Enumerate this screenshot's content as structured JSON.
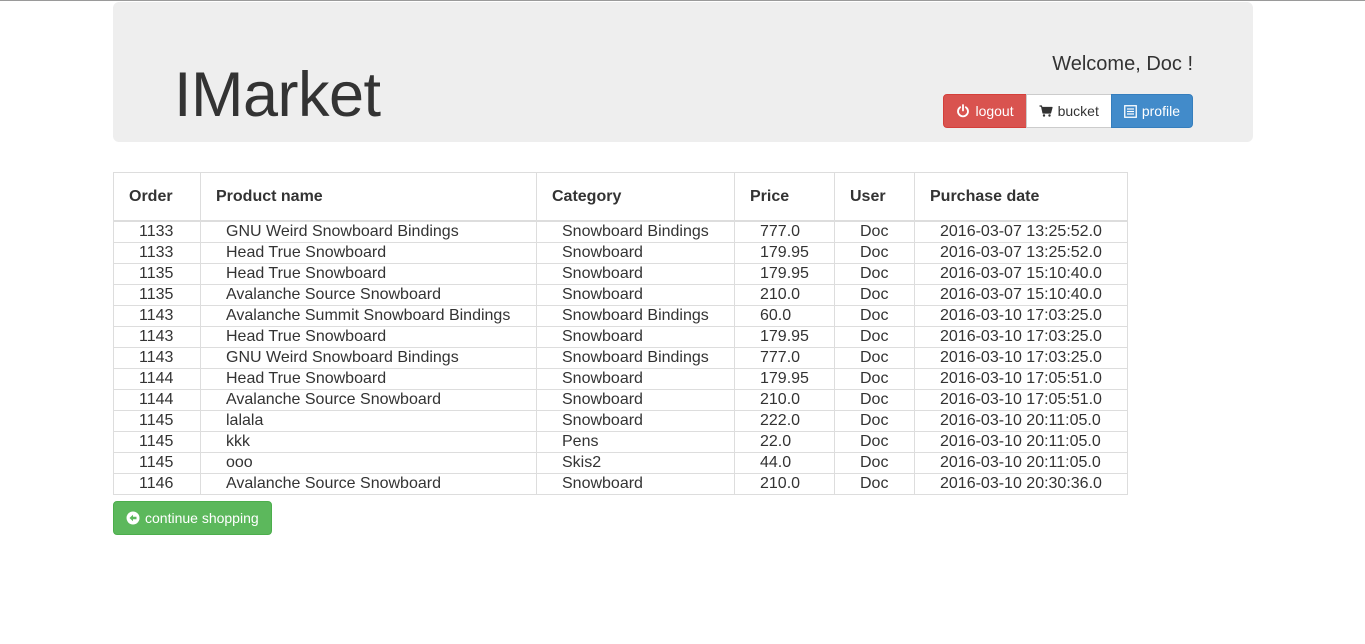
{
  "header": {
    "brand": "IMarket",
    "welcome": "Welcome, Doc !",
    "buttons": {
      "logout": "logout",
      "bucket": "bucket",
      "profile": "profile"
    }
  },
  "colors": {
    "logout": "#d9534f",
    "profile": "#428bca",
    "continue": "#5cb85c",
    "jumbotron": "#eeeeee"
  },
  "icons": {
    "logout": "power-icon",
    "bucket": "cart-icon",
    "profile": "list-icon",
    "continue": "circle-arrow-left-icon"
  },
  "table": {
    "headers": [
      "Order",
      "Product name",
      "Category",
      "Price",
      "User",
      "Purchase date"
    ],
    "rows": [
      [
        "1133",
        "GNU Weird Snowboard Bindings",
        "Snowboard Bindings",
        "777.0",
        "Doc",
        "2016-03-07 13:25:52.0"
      ],
      [
        "1133",
        "Head True Snowboard",
        "Snowboard",
        "179.95",
        "Doc",
        "2016-03-07 13:25:52.0"
      ],
      [
        "1135",
        "Head True Snowboard",
        "Snowboard",
        "179.95",
        "Doc",
        "2016-03-07 15:10:40.0"
      ],
      [
        "1135",
        "Avalanche Source Snowboard",
        "Snowboard",
        "210.0",
        "Doc",
        "2016-03-07 15:10:40.0"
      ],
      [
        "1143",
        "Avalanche Summit Snowboard Bindings",
        "Snowboard Bindings",
        "60.0",
        "Doc",
        "2016-03-10 17:03:25.0"
      ],
      [
        "1143",
        "Head True Snowboard",
        "Snowboard",
        "179.95",
        "Doc",
        "2016-03-10 17:03:25.0"
      ],
      [
        "1143",
        "GNU Weird Snowboard Bindings",
        "Snowboard Bindings",
        "777.0",
        "Doc",
        "2016-03-10 17:03:25.0"
      ],
      [
        "1144",
        "Head True Snowboard",
        "Snowboard",
        "179.95",
        "Doc",
        "2016-03-10 17:05:51.0"
      ],
      [
        "1144",
        "Avalanche Source Snowboard",
        "Snowboard",
        "210.0",
        "Doc",
        "2016-03-10 17:05:51.0"
      ],
      [
        "1145",
        "lalala",
        "Snowboard",
        "222.0",
        "Doc",
        "2016-03-10 20:11:05.0"
      ],
      [
        "1145",
        "kkk",
        "Pens",
        "22.0",
        "Doc",
        "2016-03-10 20:11:05.0"
      ],
      [
        "1145",
        "ooo",
        "Skis2",
        "44.0",
        "Doc",
        "2016-03-10 20:11:05.0"
      ],
      [
        "1146",
        "Avalanche Source Snowboard",
        "Snowboard",
        "210.0",
        "Doc",
        "2016-03-10 20:30:36.0"
      ]
    ]
  },
  "footer": {
    "continue_label": "continue shopping"
  }
}
